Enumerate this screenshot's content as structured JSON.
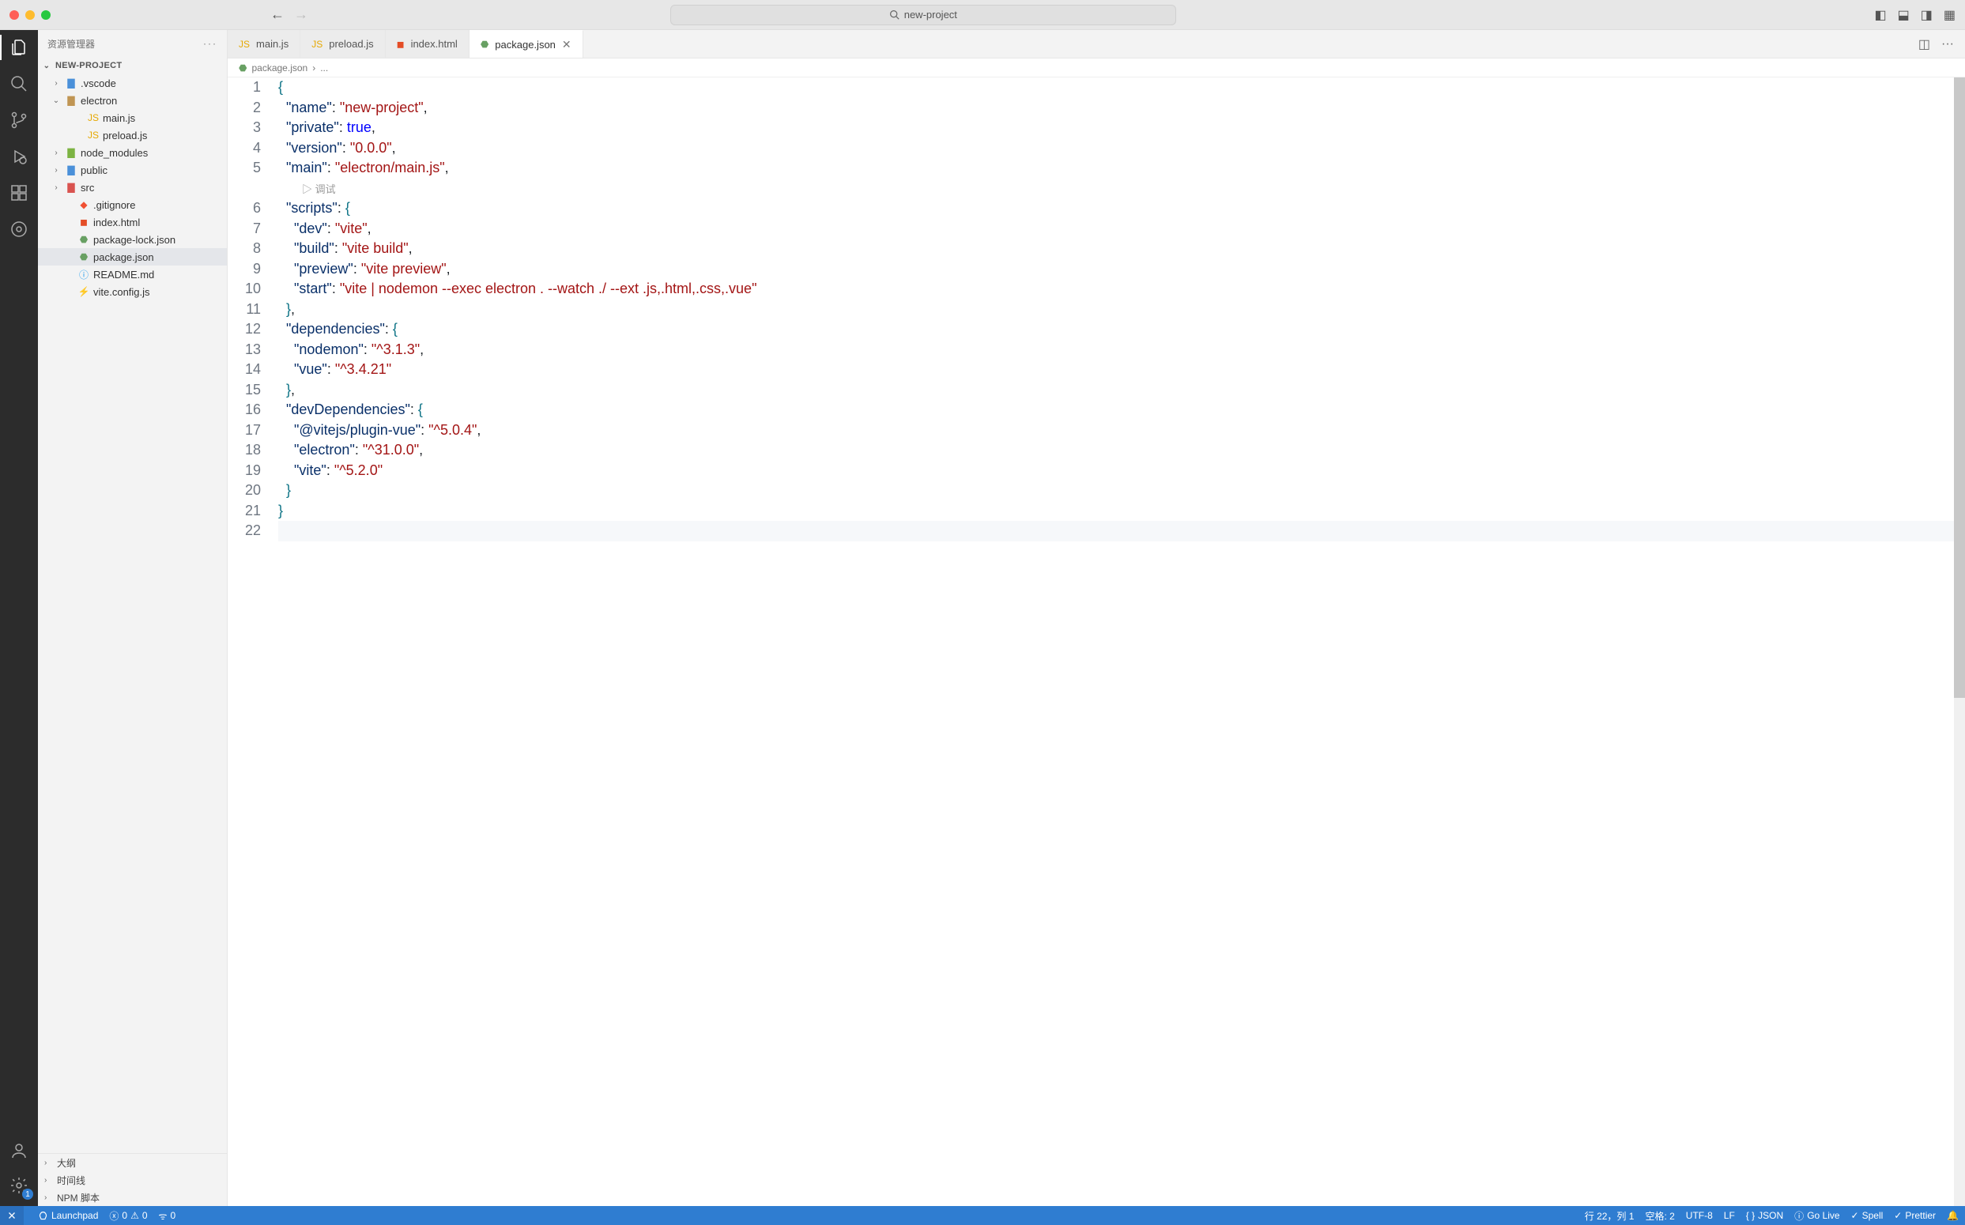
{
  "titlebar": {
    "search_label": "new-project"
  },
  "sidebar": {
    "title": "资源管理器",
    "root": "NEW-PROJECT",
    "tree": {
      "vscode": ".vscode",
      "electron": "electron",
      "main_js": "main.js",
      "preload_js": "preload.js",
      "node_modules": "node_modules",
      "public": "public",
      "src": "src",
      "gitignore": ".gitignore",
      "index_html": "index.html",
      "pkg_lock": "package-lock.json",
      "pkg": "package.json",
      "readme": "README.md",
      "vite_config": "vite.config.js"
    },
    "sections": {
      "outline": "大纲",
      "timeline": "时间线",
      "npm": "NPM 脚本"
    }
  },
  "tabs": [
    {
      "icon": "js",
      "label": "main.js"
    },
    {
      "icon": "js",
      "label": "preload.js"
    },
    {
      "icon": "html",
      "label": "index.html"
    },
    {
      "icon": "json",
      "label": "package.json"
    }
  ],
  "breadcrumb": {
    "file": "package.json",
    "rest": "..."
  },
  "debug_hint": "调试",
  "code_lines": [
    {
      "n": 1,
      "tokens": [
        {
          "c": "brace",
          "t": "{"
        }
      ]
    },
    {
      "n": 2,
      "tokens": [
        {
          "c": "ind",
          "t": "  "
        },
        {
          "c": "key",
          "t": "\"name\""
        },
        {
          "c": "punc",
          "t": ": "
        },
        {
          "c": "str",
          "t": "\"new-project\""
        },
        {
          "c": "punc",
          "t": ","
        }
      ]
    },
    {
      "n": 3,
      "tokens": [
        {
          "c": "ind",
          "t": "  "
        },
        {
          "c": "key",
          "t": "\"private\""
        },
        {
          "c": "punc",
          "t": ": "
        },
        {
          "c": "bool",
          "t": "true"
        },
        {
          "c": "punc",
          "t": ","
        }
      ]
    },
    {
      "n": 4,
      "tokens": [
        {
          "c": "ind",
          "t": "  "
        },
        {
          "c": "key",
          "t": "\"version\""
        },
        {
          "c": "punc",
          "t": ": "
        },
        {
          "c": "str",
          "t": "\"0.0.0\""
        },
        {
          "c": "punc",
          "t": ","
        }
      ]
    },
    {
      "n": 5,
      "tokens": [
        {
          "c": "ind",
          "t": "  "
        },
        {
          "c": "key",
          "t": "\"main\""
        },
        {
          "c": "punc",
          "t": ": "
        },
        {
          "c": "str",
          "t": "\"electron/main.js\""
        },
        {
          "c": "punc",
          "t": ","
        }
      ]
    },
    {
      "n": 0,
      "debug": true
    },
    {
      "n": 6,
      "tokens": [
        {
          "c": "ind",
          "t": "  "
        },
        {
          "c": "key",
          "t": "\"scripts\""
        },
        {
          "c": "punc",
          "t": ": "
        },
        {
          "c": "brace",
          "t": "{"
        }
      ]
    },
    {
      "n": 7,
      "tokens": [
        {
          "c": "ind",
          "t": "    "
        },
        {
          "c": "key",
          "t": "\"dev\""
        },
        {
          "c": "punc",
          "t": ": "
        },
        {
          "c": "str",
          "t": "\"vite\""
        },
        {
          "c": "punc",
          "t": ","
        }
      ]
    },
    {
      "n": 8,
      "tokens": [
        {
          "c": "ind",
          "t": "    "
        },
        {
          "c": "key",
          "t": "\"build\""
        },
        {
          "c": "punc",
          "t": ": "
        },
        {
          "c": "str",
          "t": "\"vite build\""
        },
        {
          "c": "punc",
          "t": ","
        }
      ]
    },
    {
      "n": 9,
      "tokens": [
        {
          "c": "ind",
          "t": "    "
        },
        {
          "c": "key",
          "t": "\"preview\""
        },
        {
          "c": "punc",
          "t": ": "
        },
        {
          "c": "str",
          "t": "\"vite preview\""
        },
        {
          "c": "punc",
          "t": ","
        }
      ]
    },
    {
      "n": 10,
      "tokens": [
        {
          "c": "ind",
          "t": "    "
        },
        {
          "c": "key",
          "t": "\"start\""
        },
        {
          "c": "punc",
          "t": ": "
        },
        {
          "c": "str",
          "t": "\"vite | nodemon --exec electron . --watch ./ --ext .js,.html,.css,.vue\""
        }
      ]
    },
    {
      "n": 11,
      "tokens": [
        {
          "c": "ind",
          "t": "  "
        },
        {
          "c": "brace",
          "t": "}"
        },
        {
          "c": "punc",
          "t": ","
        }
      ]
    },
    {
      "n": 12,
      "tokens": [
        {
          "c": "ind",
          "t": "  "
        },
        {
          "c": "key",
          "t": "\"dependencies\""
        },
        {
          "c": "punc",
          "t": ": "
        },
        {
          "c": "brace",
          "t": "{"
        }
      ]
    },
    {
      "n": 13,
      "tokens": [
        {
          "c": "ind",
          "t": "    "
        },
        {
          "c": "key",
          "t": "\"nodemon\""
        },
        {
          "c": "punc",
          "t": ": "
        },
        {
          "c": "str",
          "t": "\"^3.1.3\""
        },
        {
          "c": "punc",
          "t": ","
        }
      ]
    },
    {
      "n": 14,
      "tokens": [
        {
          "c": "ind",
          "t": "    "
        },
        {
          "c": "key",
          "t": "\"vue\""
        },
        {
          "c": "punc",
          "t": ": "
        },
        {
          "c": "str",
          "t": "\"^3.4.21\""
        }
      ]
    },
    {
      "n": 15,
      "tokens": [
        {
          "c": "ind",
          "t": "  "
        },
        {
          "c": "brace",
          "t": "}"
        },
        {
          "c": "punc",
          "t": ","
        }
      ]
    },
    {
      "n": 16,
      "tokens": [
        {
          "c": "ind",
          "t": "  "
        },
        {
          "c": "key",
          "t": "\"devDependencies\""
        },
        {
          "c": "punc",
          "t": ": "
        },
        {
          "c": "brace",
          "t": "{"
        }
      ]
    },
    {
      "n": 17,
      "tokens": [
        {
          "c": "ind",
          "t": "    "
        },
        {
          "c": "key",
          "t": "\"@vitejs/plugin-vue\""
        },
        {
          "c": "punc",
          "t": ": "
        },
        {
          "c": "str",
          "t": "\"^5.0.4\""
        },
        {
          "c": "punc",
          "t": ","
        }
      ]
    },
    {
      "n": 18,
      "tokens": [
        {
          "c": "ind",
          "t": "    "
        },
        {
          "c": "key",
          "t": "\"electron\""
        },
        {
          "c": "punc",
          "t": ": "
        },
        {
          "c": "str",
          "t": "\"^31.0.0\""
        },
        {
          "c": "punc",
          "t": ","
        }
      ]
    },
    {
      "n": 19,
      "tokens": [
        {
          "c": "ind",
          "t": "    "
        },
        {
          "c": "key",
          "t": "\"vite\""
        },
        {
          "c": "punc",
          "t": ": "
        },
        {
          "c": "str",
          "t": "\"^5.2.0\""
        }
      ]
    },
    {
      "n": 20,
      "tokens": [
        {
          "c": "ind",
          "t": "  "
        },
        {
          "c": "brace",
          "t": "}"
        }
      ]
    },
    {
      "n": 21,
      "tokens": [
        {
          "c": "brace",
          "t": "}"
        }
      ]
    },
    {
      "n": 22,
      "current": true,
      "tokens": []
    }
  ],
  "statusbar": {
    "launchpad": "Launchpad",
    "errors": "0",
    "warnings": "0",
    "ports": "0",
    "line_col": "行 22，列 1",
    "spaces": "空格: 2",
    "encoding": "UTF-8",
    "eol": "LF",
    "lang": "JSON",
    "golive": "Go Live",
    "spell": "Spell",
    "prettier": "Prettier"
  },
  "colors": {
    "statusbar": "#2f7dd1",
    "activity": "#2c2c2c"
  }
}
